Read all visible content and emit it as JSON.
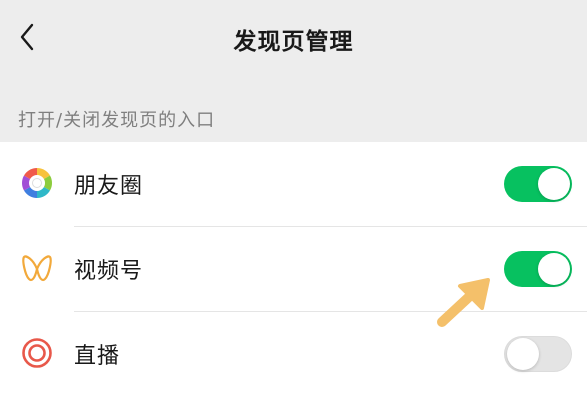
{
  "header": {
    "title": "发现页管理",
    "back_icon": "chevron-left-icon"
  },
  "section": {
    "label": "打开/关闭发现页的入口"
  },
  "items": [
    {
      "label": "朋友圈",
      "icon": "moments-aperture-icon",
      "enabled": true
    },
    {
      "label": "视频号",
      "icon": "channels-butterfly-icon",
      "enabled": true
    },
    {
      "label": "直播",
      "icon": "live-concentric-circles-icon",
      "enabled": false
    }
  ],
  "colors": {
    "toggle_on": "#07c160",
    "toggle_off": "#e4e4e4",
    "annotation_arrow": "#f4c06a",
    "background": "#ededed"
  },
  "annotation": {
    "icon": "pointer-arrow-icon"
  }
}
